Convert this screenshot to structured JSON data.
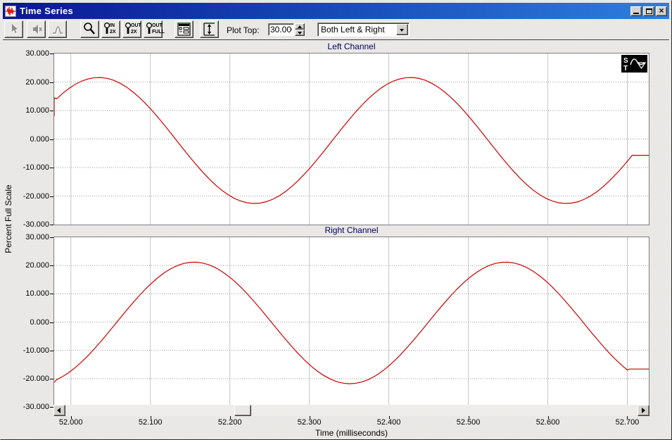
{
  "window": {
    "title": "Time Series"
  },
  "toolbar": {
    "plot_top_label": "Plot Top:",
    "plot_top_value": "30.000",
    "channel_select_value": "Both Left & Right",
    "buttons": [
      {
        "name": "select-cursor",
        "icon": "cursor-arrow-icon",
        "disabled": true
      },
      {
        "name": "mute",
        "icon": "muted-speaker-icon",
        "disabled": true
      },
      {
        "name": "peak",
        "icon": "peak-curve-icon",
        "disabled": true
      },
      {
        "name": "zoom-tool",
        "icon": "magnifier-icon",
        "disabled": false
      },
      {
        "name": "zoom-in-2x",
        "icon": "magnifier-icon",
        "text_top": "IN",
        "text_bottom": "2X"
      },
      {
        "name": "zoom-out-2x",
        "icon": "magnifier-icon",
        "text_top": "OUT",
        "text_bottom": "2X"
      },
      {
        "name": "zoom-out-full",
        "icon": "magnifier-icon",
        "text_top": "OUT",
        "text_bottom": "FULL"
      },
      {
        "name": "display-options",
        "icon": "display-options-icon"
      },
      {
        "name": "plot-range",
        "icon": "vertical-range-icon"
      }
    ]
  },
  "chart_data": {
    "type": "line",
    "xlabel": "Time (milliseconds)",
    "ylabel": "Percent Full Scale",
    "x_range": [
      51.979,
      52.727
    ],
    "y_range": [
      -30,
      30
    ],
    "grid": true,
    "line_color": "#cc0000",
    "x_ticks": [
      {
        "value": 52.0,
        "label": "52.000"
      },
      {
        "value": 52.1,
        "label": "52.100"
      },
      {
        "value": 52.2,
        "label": "52.200"
      },
      {
        "value": 52.3,
        "label": "52.300"
      },
      {
        "value": 52.4,
        "label": "52.400"
      },
      {
        "value": 52.5,
        "label": "52.500"
      },
      {
        "value": 52.6,
        "label": "52.600"
      },
      {
        "value": 52.7,
        "label": "52.700"
      }
    ],
    "y_ticks": [
      {
        "value": 30,
        "label": "30.000"
      },
      {
        "value": 20,
        "label": "20.000"
      },
      {
        "value": 10,
        "label": "10.000"
      },
      {
        "value": 0,
        "label": "0.000"
      },
      {
        "value": -10,
        "label": "-10.000"
      },
      {
        "value": -20,
        "label": "-20.000"
      },
      {
        "value": -30,
        "label": "-30.000"
      }
    ],
    "plots": [
      {
        "title": "Left Channel",
        "series": {
          "name": "left-channel",
          "prefix": [
            [
              51.979,
              8.0
            ],
            [
              51.979,
              14.5
            ]
          ],
          "model": {
            "offset": -0.5,
            "amplitude": 22.1,
            "period_ms": 0.392,
            "peak_t": 52.035,
            "t_start": 51.982,
            "t_end": 52.704,
            "sample_step": 0.008
          },
          "suffix": [
            [
              52.706,
              -5.7
            ],
            [
              52.727,
              -5.7
            ]
          ],
          "key_points": [
            [
              51.979,
              8.0
            ],
            [
              51.979,
              14.5
            ],
            [
              52.035,
              21.6
            ],
            [
              52.131,
              0.0
            ],
            [
              52.231,
              -22.6
            ],
            [
              52.329,
              0.0
            ],
            [
              52.427,
              21.6
            ],
            [
              52.525,
              0.0
            ],
            [
              52.623,
              -22.6
            ],
            [
              52.706,
              -5.7
            ],
            [
              52.727,
              -5.7
            ]
          ]
        }
      },
      {
        "title": "Right Channel",
        "series": {
          "name": "right-channel",
          "prefix": [
            [
              51.979,
              -21.3
            ]
          ],
          "model": {
            "offset": -0.3,
            "amplitude": 21.5,
            "period_ms": 0.392,
            "peak_t": 52.155,
            "t_start": 51.982,
            "t_end": 52.7,
            "sample_step": 0.008
          },
          "suffix": [
            [
              52.703,
              -16.6
            ],
            [
              52.727,
              -16.6
            ]
          ],
          "key_points": [
            [
              51.979,
              -21.3
            ],
            [
              52.057,
              0.0
            ],
            [
              52.155,
              21.2
            ],
            [
              52.253,
              0.0
            ],
            [
              52.351,
              -21.8
            ],
            [
              52.449,
              0.0
            ],
            [
              52.547,
              21.2
            ],
            [
              52.645,
              0.0
            ],
            [
              52.703,
              -16.6
            ],
            [
              52.727,
              -16.6
            ]
          ]
        }
      }
    ]
  }
}
